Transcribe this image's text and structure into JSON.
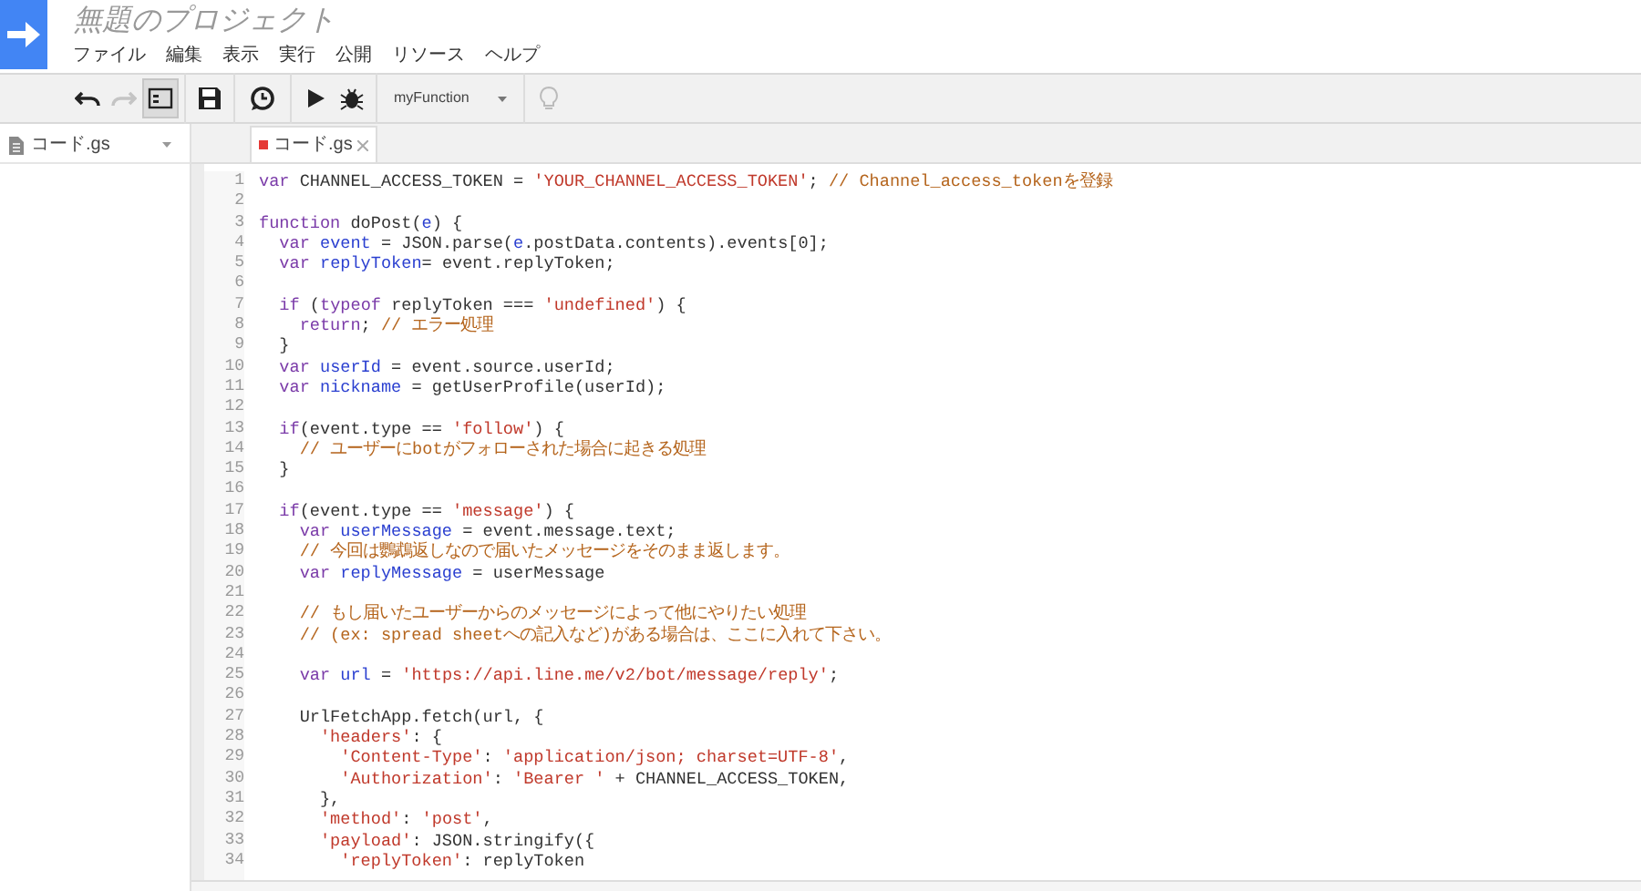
{
  "header": {
    "title": "無題のプロジェクト",
    "menu": [
      "ファイル",
      "編集",
      "表示",
      "実行",
      "公開",
      "リソース",
      "ヘルプ"
    ]
  },
  "toolbar": [
    {
      "kind": "undo",
      "disabled": false
    },
    {
      "kind": "redo",
      "disabled": true
    },
    {
      "kind": "sidebar",
      "pressed": true
    },
    {
      "kind": "save"
    },
    {
      "kind": "triggers"
    },
    {
      "kind": "run"
    },
    {
      "kind": "debug"
    },
    {
      "kind": "select",
      "label": "myFunction"
    },
    {
      "kind": "bulb"
    }
  ],
  "sidebar": {
    "files": [
      {
        "name": "コード.gs"
      }
    ]
  },
  "tabs": [
    {
      "label": "コード.gs",
      "modified": true,
      "selected": true
    }
  ],
  "code": [
    {
      "number": "1",
      "tokens": [
        {
          "kind": "keyword",
          "text": "var"
        },
        {
          "kind": "plain",
          "text": " CHANNEL_ACCESS_TOKEN = "
        },
        {
          "kind": "string",
          "text": "'YOUR_CHANNEL_ACCESS_TOKEN'"
        },
        {
          "kind": "plain",
          "text": "; "
        },
        {
          "kind": "comment",
          "text": "// Channel_access_tokenを登録"
        }
      ]
    },
    {
      "number": "2"
    },
    {
      "number": "3",
      "tokens": [
        {
          "kind": "keyword",
          "text": "function"
        },
        {
          "kind": "plain",
          "text": " doPost("
        },
        {
          "kind": "variable",
          "text": "e"
        },
        {
          "kind": "plain",
          "text": ") {"
        }
      ]
    },
    {
      "number": "4",
      "tokens": [
        {
          "kind": "keyword",
          "text": "  var"
        },
        {
          "kind": "variable",
          "text": " event"
        },
        {
          "kind": "plain",
          "text": " = JSON.parse("
        },
        {
          "kind": "variable",
          "text": "e"
        },
        {
          "kind": "plain",
          "text": ".postData.contents).events[0];"
        }
      ]
    },
    {
      "number": "5",
      "tokens": [
        {
          "kind": "keyword",
          "text": "  var"
        },
        {
          "kind": "variable",
          "text": " replyToken"
        },
        {
          "kind": "plain",
          "text": "= event.replyToken;"
        }
      ]
    },
    {
      "number": "6"
    },
    {
      "number": "7",
      "tokens": [
        {
          "kind": "keyword",
          "text": "  if"
        },
        {
          "kind": "plain",
          "text": " ("
        },
        {
          "kind": "keyword",
          "text": "typeof"
        },
        {
          "kind": "plain",
          "text": " replyToken === "
        },
        {
          "kind": "string",
          "text": "'undefined'"
        },
        {
          "kind": "plain",
          "text": ") {"
        }
      ]
    },
    {
      "number": "8",
      "tokens": [
        {
          "kind": "keyword",
          "text": "    return"
        },
        {
          "kind": "plain",
          "text": "; "
        },
        {
          "kind": "comment",
          "text": "// エラー処理"
        }
      ]
    },
    {
      "number": "9",
      "tokens": [
        {
          "kind": "plain",
          "text": "  }"
        }
      ]
    },
    {
      "number": "10",
      "tokens": [
        {
          "kind": "keyword",
          "text": "  var"
        },
        {
          "kind": "variable",
          "text": " userId"
        },
        {
          "kind": "plain",
          "text": " = event.source.userId;"
        }
      ]
    },
    {
      "number": "11",
      "tokens": [
        {
          "kind": "keyword",
          "text": "  var"
        },
        {
          "kind": "variable",
          "text": " nickname"
        },
        {
          "kind": "plain",
          "text": " = getUserProfile(userId);"
        }
      ]
    },
    {
      "number": "12"
    },
    {
      "number": "13",
      "tokens": [
        {
          "kind": "keyword",
          "text": "  if"
        },
        {
          "kind": "plain",
          "text": "(event.type == "
        },
        {
          "kind": "string",
          "text": "'follow'"
        },
        {
          "kind": "plain",
          "text": ") {"
        }
      ]
    },
    {
      "number": "14",
      "tokens": [
        {
          "kind": "comment",
          "text": "    // ユーザーにbotがフォローされた場合に起きる処理"
        }
      ]
    },
    {
      "number": "15",
      "tokens": [
        {
          "kind": "plain",
          "text": "  }"
        }
      ]
    },
    {
      "number": "16"
    },
    {
      "number": "17",
      "tokens": [
        {
          "kind": "keyword",
          "text": "  if"
        },
        {
          "kind": "plain",
          "text": "(event.type == "
        },
        {
          "kind": "string",
          "text": "'message'"
        },
        {
          "kind": "plain",
          "text": ") {"
        }
      ]
    },
    {
      "number": "18",
      "tokens": [
        {
          "kind": "keyword",
          "text": "    var"
        },
        {
          "kind": "variable",
          "text": " userMessage"
        },
        {
          "kind": "plain",
          "text": " = event.message.text;"
        }
      ]
    },
    {
      "number": "19",
      "tokens": [
        {
          "kind": "comment",
          "text": "    // 今回は鸚鵡返しなので届いたメッセージをそのまま返します。"
        }
      ]
    },
    {
      "number": "20",
      "tokens": [
        {
          "kind": "keyword",
          "text": "    var"
        },
        {
          "kind": "variable",
          "text": " replyMessage"
        },
        {
          "kind": "plain",
          "text": " = userMessage"
        }
      ]
    },
    {
      "number": "21"
    },
    {
      "number": "22",
      "tokens": [
        {
          "kind": "comment",
          "text": "    // もし届いたユーザーからのメッセージによって他にやりたい処理"
        }
      ]
    },
    {
      "number": "23",
      "tokens": [
        {
          "kind": "comment",
          "text": "    // (ex: spread sheetへの記入など)がある場合は、ここに入れて下さい。"
        }
      ]
    },
    {
      "number": "24"
    },
    {
      "number": "25",
      "tokens": [
        {
          "kind": "keyword",
          "text": "    var"
        },
        {
          "kind": "variable",
          "text": " url"
        },
        {
          "kind": "plain",
          "text": " = "
        },
        {
          "kind": "string",
          "text": "'https://api.line.me/v2/bot/message/reply'"
        },
        {
          "kind": "plain",
          "text": ";"
        }
      ]
    },
    {
      "number": "26"
    },
    {
      "number": "27",
      "tokens": [
        {
          "kind": "plain",
          "text": "    UrlFetchApp.fetch(url, {"
        }
      ]
    },
    {
      "number": "28",
      "tokens": [
        {
          "kind": "string",
          "text": "      'headers'"
        },
        {
          "kind": "plain",
          "text": ": {"
        }
      ]
    },
    {
      "number": "29",
      "tokens": [
        {
          "kind": "string",
          "text": "        'Content-Type'"
        },
        {
          "kind": "plain",
          "text": ": "
        },
        {
          "kind": "string",
          "text": "'application/json; charset=UTF-8'"
        },
        {
          "kind": "plain",
          "text": ","
        }
      ]
    },
    {
      "number": "30",
      "tokens": [
        {
          "kind": "string",
          "text": "        'Authorization'"
        },
        {
          "kind": "plain",
          "text": ": "
        },
        {
          "kind": "string",
          "text": "'Bearer '"
        },
        {
          "kind": "plain",
          "text": " + CHANNEL_ACCESS_TOKEN,"
        }
      ]
    },
    {
      "number": "31",
      "tokens": [
        {
          "kind": "plain",
          "text": "      },"
        }
      ]
    },
    {
      "number": "32",
      "tokens": [
        {
          "kind": "string",
          "text": "      'method'"
        },
        {
          "kind": "plain",
          "text": ": "
        },
        {
          "kind": "string",
          "text": "'post'"
        },
        {
          "kind": "plain",
          "text": ","
        }
      ]
    },
    {
      "number": "33",
      "tokens": [
        {
          "kind": "string",
          "text": "      'payload'"
        },
        {
          "kind": "plain",
          "text": ": JSON.stringify({"
        }
      ]
    },
    {
      "number": "34",
      "tokens": [
        {
          "kind": "string",
          "text": "        'replyToken'"
        },
        {
          "kind": "plain",
          "text": ": replyToken"
        }
      ]
    }
  ]
}
